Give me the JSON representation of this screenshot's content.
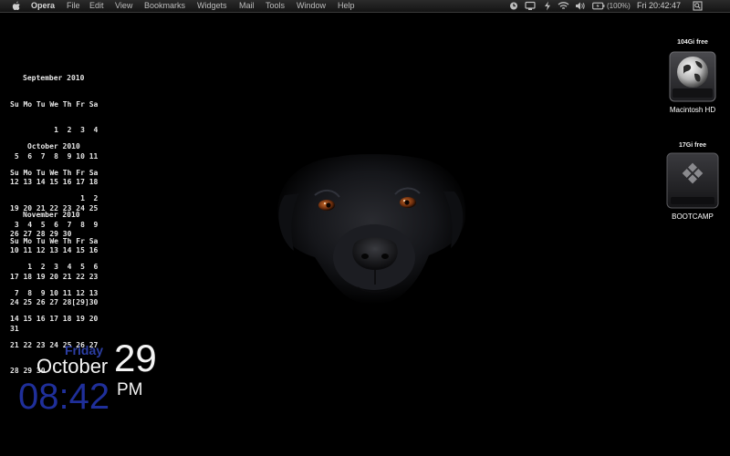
{
  "menubar": {
    "app_name": "Opera",
    "items": [
      "File",
      "Edit",
      "View",
      "Bookmarks",
      "Widgets",
      "Mail",
      "Tools",
      "Window",
      "Help"
    ],
    "battery": "(100%)",
    "clock": "Fri 20:42:47",
    "status_icons": [
      "clock-icon",
      "display-icon",
      "bolt-icon",
      "wifi-icon",
      "volume-icon",
      "battery-icon",
      "spotlight-icon"
    ]
  },
  "calendars": [
    {
      "title": "September 2010",
      "header": "Su Mo Tu We Th Fr Sa",
      "weeks": [
        "          1  2  3  4",
        " 5  6  7  8  9 10 11",
        "12 13 14 15 16 17 18",
        "19 20 21 22 23 24 25",
        "26 27 28 29 30"
      ]
    },
    {
      "title": "October 2010",
      "header": "Su Mo Tu We Th Fr Sa",
      "weeks": [
        "                1  2",
        " 3  4  5  6  7  8  9",
        "10 11 12 13 14 15 16",
        "17 18 19 20 21 22 23",
        "24 25 26 27 28[29]30",
        "31"
      ]
    },
    {
      "title": "November 2010",
      "header": "Su Mo Tu We Th Fr Sa",
      "weeks": [
        "    1  2  3  4  5  6",
        " 7  8  9 10 11 12 13",
        "14 15 16 17 18 19 20",
        "21 22 23 24 25 26 27",
        "28 29 30"
      ]
    }
  ],
  "clock_widget": {
    "day": "Friday",
    "month": "October",
    "date": "29",
    "time": "08:42",
    "ampm": "PM"
  },
  "drives": [
    {
      "free": "104Gi free",
      "name": "Macintosh HD"
    },
    {
      "free": "17Gi free",
      "name": "BOOTCAMP"
    }
  ],
  "colors": {
    "menubar": "#1e1e1e",
    "widget_blue": "#1f2f9a",
    "eye": "#8a3a10"
  }
}
